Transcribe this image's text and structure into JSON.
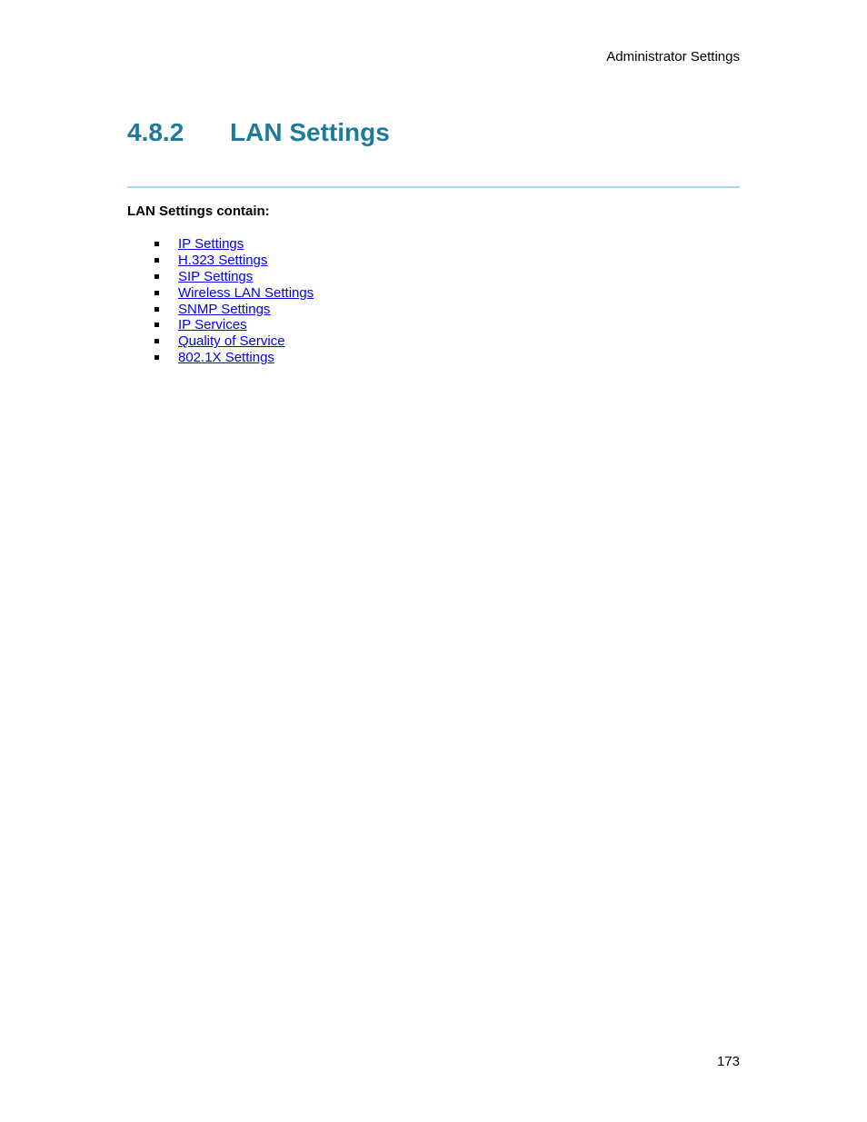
{
  "header": {
    "running_title": "Administrator Settings"
  },
  "section": {
    "number": "4.8.2",
    "title": "LAN Settings",
    "intro": "LAN Settings contain:"
  },
  "links": [
    {
      "label": "IP Settings"
    },
    {
      "label": "H.323 Settings"
    },
    {
      "label": "SIP Settings"
    },
    {
      "label": "Wireless LAN Settings"
    },
    {
      "label": "SNMP Settings"
    },
    {
      "label": "IP Services"
    },
    {
      "label": "Quality of Service"
    },
    {
      "label": "802.1X Settings"
    }
  ],
  "footer": {
    "page_number": "173"
  },
  "colors": {
    "heading": "#1f7a9a",
    "rule": "#a9d9e6",
    "link": "#0000ee"
  }
}
